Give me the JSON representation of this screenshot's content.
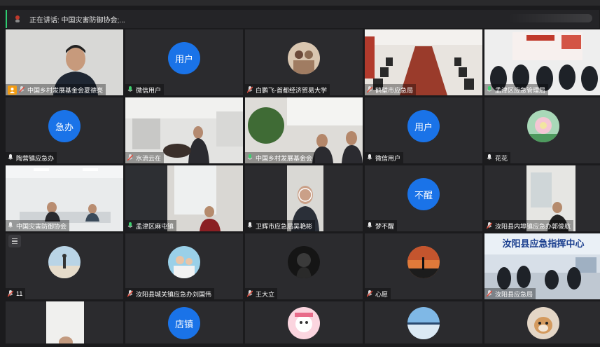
{
  "speaker_bar": {
    "text": "正在讲话: 中国灾害防御协会;..."
  },
  "colors": {
    "accent_green": "#3ecf6e",
    "avatar_blue": "#1a73e8",
    "tile_bg": "#2b2b2e"
  },
  "tiles": [
    {
      "name": "中国乡村发展基金会夏德亮",
      "type": "video",
      "mic": "muted",
      "host": true
    },
    {
      "name": "微信用户",
      "type": "text-avatar",
      "avatar_text": "用户",
      "mic": "on"
    },
    {
      "name": "白鹏飞-首都经济贸易大学",
      "type": "image-avatar",
      "mic": "muted"
    },
    {
      "name": "鹤壁市应急局",
      "type": "video",
      "mic": "muted"
    },
    {
      "name": "孟津区应急管理局",
      "type": "video",
      "mic": "on"
    },
    {
      "name": "陶营镇应急办",
      "type": "text-avatar",
      "avatar_text": "急办",
      "mic": "on"
    },
    {
      "name": "水流云在",
      "type": "video",
      "mic": "muted"
    },
    {
      "name": "中国乡村发展基金会",
      "type": "video",
      "mic": "on"
    },
    {
      "name": "微信用户",
      "type": "text-avatar",
      "avatar_text": "用户",
      "mic": "on"
    },
    {
      "name": "花花",
      "type": "image-avatar",
      "mic": "on"
    },
    {
      "name": "中国灾害防御协会",
      "type": "video",
      "mic": "on",
      "active": true
    },
    {
      "name": "孟津区麻屯镇",
      "type": "video",
      "mic": "on"
    },
    {
      "name": "卫辉市应急局吴艳彬",
      "type": "video",
      "mic": "on"
    },
    {
      "name": "梦不醒",
      "type": "text-avatar",
      "avatar_text": "不醒",
      "mic": "on"
    },
    {
      "name": "汝阳县内埠镇应急办郭俊航",
      "type": "video",
      "mic": "muted"
    },
    {
      "name": "11",
      "type": "image-avatar",
      "mic": "muted"
    },
    {
      "name": "汝阳县城关镇应急办刘国伟",
      "type": "image-avatar",
      "mic": "muted"
    },
    {
      "name": "王大立",
      "type": "image-avatar",
      "mic": "muted"
    },
    {
      "name": "心愿",
      "type": "image-avatar",
      "mic": "muted"
    },
    {
      "name": "汝阳县应急局",
      "type": "video",
      "mic": "muted",
      "banner": "汝阳县应急指挥中心"
    },
    {
      "name": "",
      "type": "video",
      "mic": "none"
    },
    {
      "name": "",
      "type": "text-avatar",
      "avatar_text": "店镇",
      "mic": "none"
    },
    {
      "name": "",
      "type": "image-avatar",
      "mic": "none"
    },
    {
      "name": "",
      "type": "image-avatar",
      "mic": "none"
    },
    {
      "name": "",
      "type": "image-avatar",
      "mic": "none"
    }
  ]
}
